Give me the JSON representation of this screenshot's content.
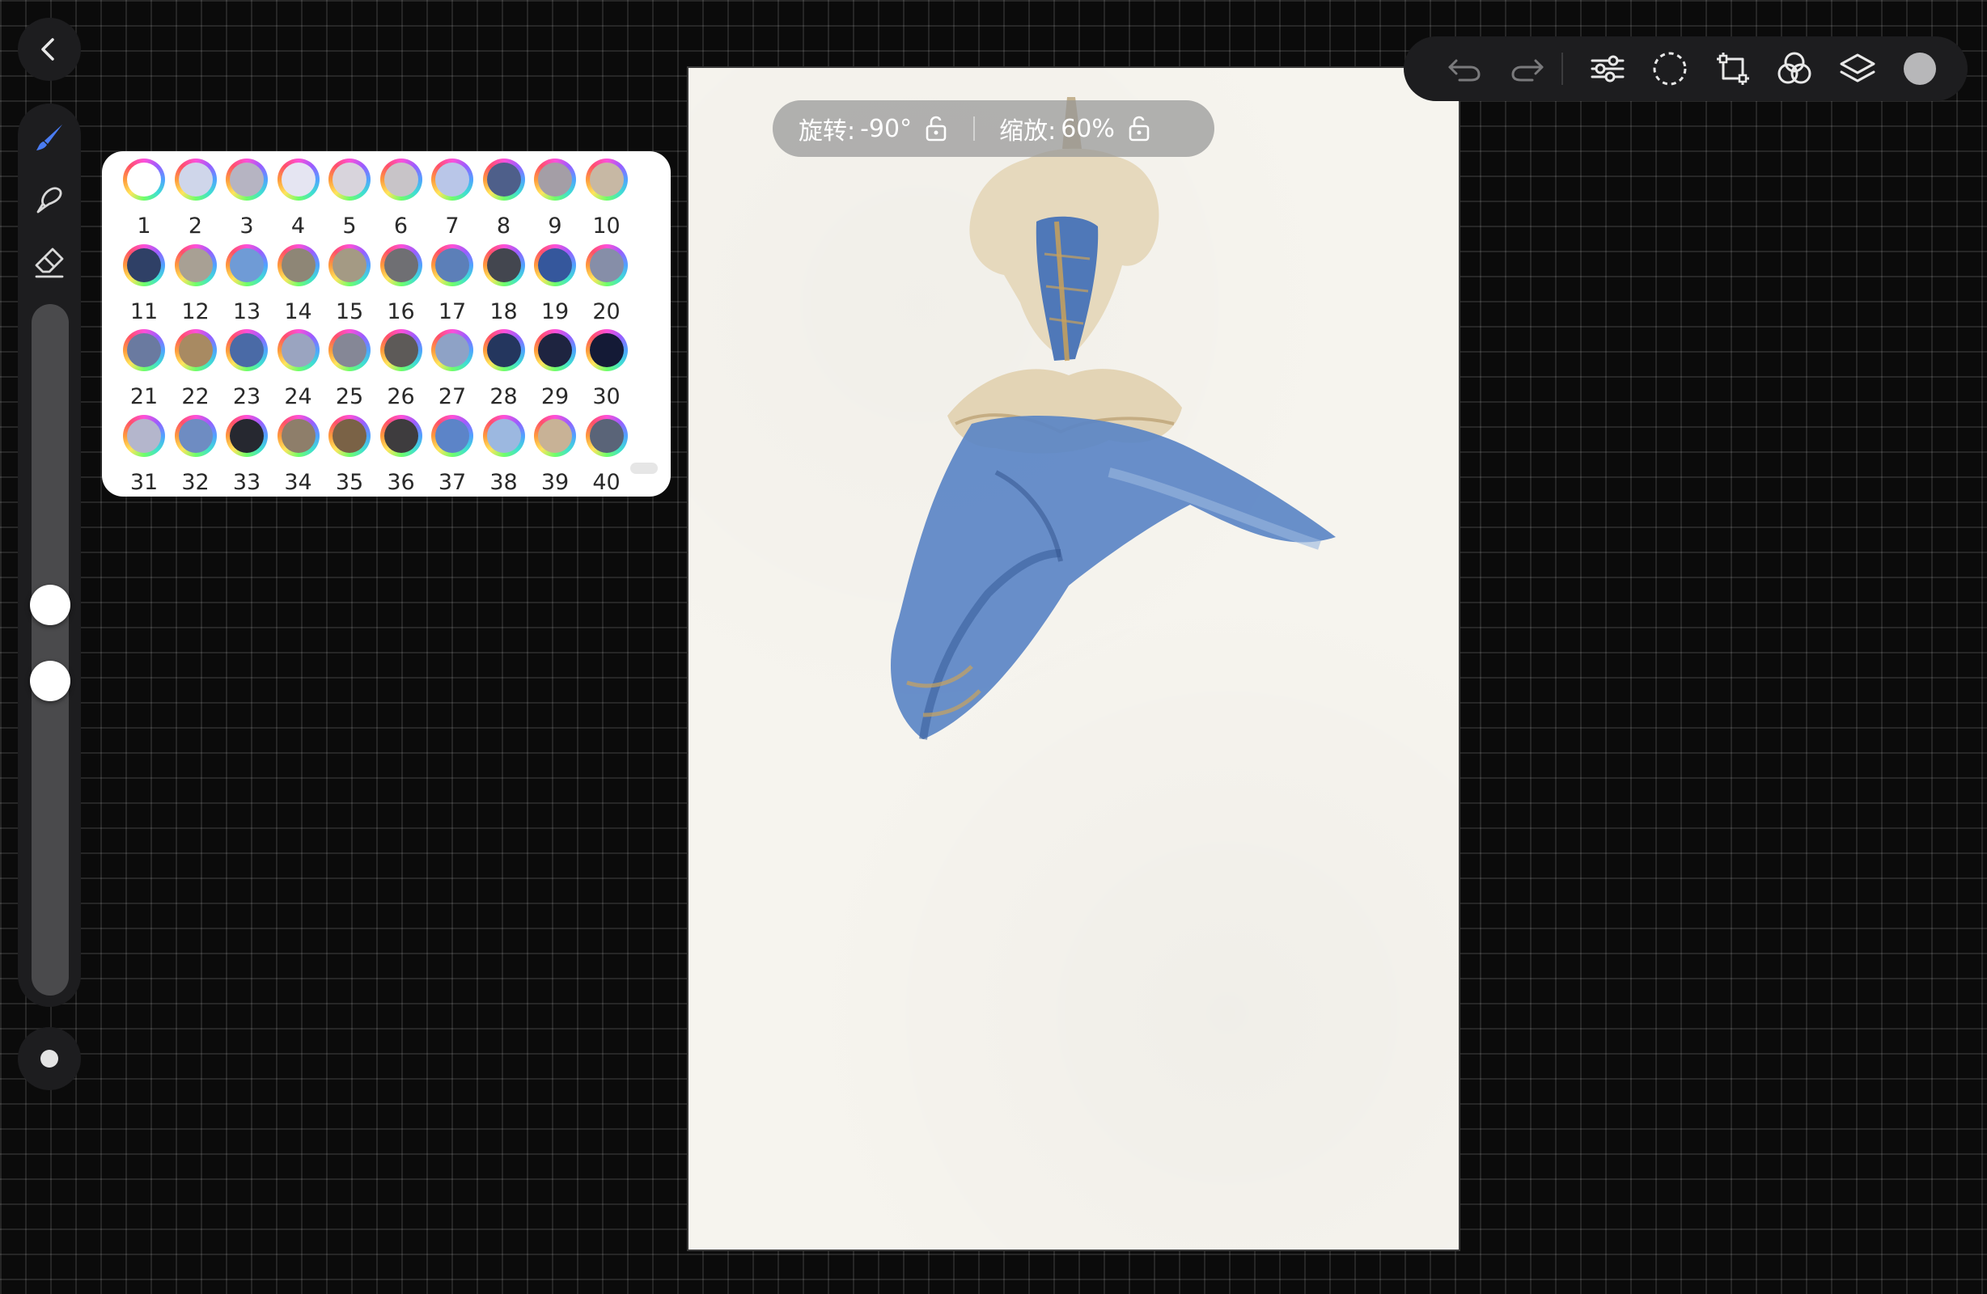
{
  "hud": {
    "rotate_label": "旋转:",
    "rotate_value": "-90°",
    "zoom_label": "缩放:",
    "zoom_value": "60%"
  },
  "left_toolbar": {
    "tools": [
      "brush-icon",
      "smudge-icon",
      "eraser-icon"
    ],
    "brush_size_fraction": 0.45,
    "opacity_fraction": 0.56
  },
  "top_toolbar": {
    "icons": [
      "undo-icon",
      "redo-icon",
      "adjustments-icon",
      "selection-icon",
      "transform-icon",
      "blend-icon",
      "layers-icon",
      "color-icon"
    ],
    "current_color": "#b7b7b9",
    "accent_color": "#4a7cf2"
  },
  "palette": {
    "swatches": [
      {
        "label": "1",
        "color": "#ffffff"
      },
      {
        "label": "2",
        "color": "#cfd6ea"
      },
      {
        "label": "3",
        "color": "#b6b4c2"
      },
      {
        "label": "4",
        "color": "#e5e5f2"
      },
      {
        "label": "5",
        "color": "#d8d4dc"
      },
      {
        "label": "6",
        "color": "#c8c4c8"
      },
      {
        "label": "7",
        "color": "#b9c6e8"
      },
      {
        "label": "8",
        "color": "#4e5f8a"
      },
      {
        "label": "9",
        "color": "#a49ea6"
      },
      {
        "label": "10",
        "color": "#c7b8a4"
      },
      {
        "label": "11",
        "color": "#2f4066"
      },
      {
        "label": "12",
        "color": "#a8a094"
      },
      {
        "label": "13",
        "color": "#6f9bd6"
      },
      {
        "label": "14",
        "color": "#8e8676"
      },
      {
        "label": "15",
        "color": "#a49a84"
      },
      {
        "label": "16",
        "color": "#6f6f73"
      },
      {
        "label": "17",
        "color": "#5c7fb8"
      },
      {
        "label": "18",
        "color": "#43464f"
      },
      {
        "label": "19",
        "color": "#35579c"
      },
      {
        "label": "20",
        "color": "#868ea8"
      },
      {
        "label": "21",
        "color": "#6a7aa0"
      },
      {
        "label": "22",
        "color": "#a88a62"
      },
      {
        "label": "23",
        "color": "#4a6aa6"
      },
      {
        "label": "24",
        "color": "#9aa4c0"
      },
      {
        "label": "25",
        "color": "#858796"
      },
      {
        "label": "26",
        "color": "#5d5a58"
      },
      {
        "label": "27",
        "color": "#8ea2c6"
      },
      {
        "label": "28",
        "color": "#24365e"
      },
      {
        "label": "29",
        "color": "#1e2440"
      },
      {
        "label": "30",
        "color": "#141a36"
      },
      {
        "label": "31",
        "color": "#b4b6cc"
      },
      {
        "label": "32",
        "color": "#6e8cc2"
      },
      {
        "label": "33",
        "color": "#262830"
      },
      {
        "label": "34",
        "color": "#8e7e6a"
      },
      {
        "label": "35",
        "color": "#7a6246"
      },
      {
        "label": "36",
        "color": "#3e3c3e"
      },
      {
        "label": "37",
        "color": "#5c84c8"
      },
      {
        "label": "38",
        "color": "#9cb8e0"
      },
      {
        "label": "39",
        "color": "#c8b296"
      },
      {
        "label": "40",
        "color": "#5a6478"
      }
    ]
  }
}
